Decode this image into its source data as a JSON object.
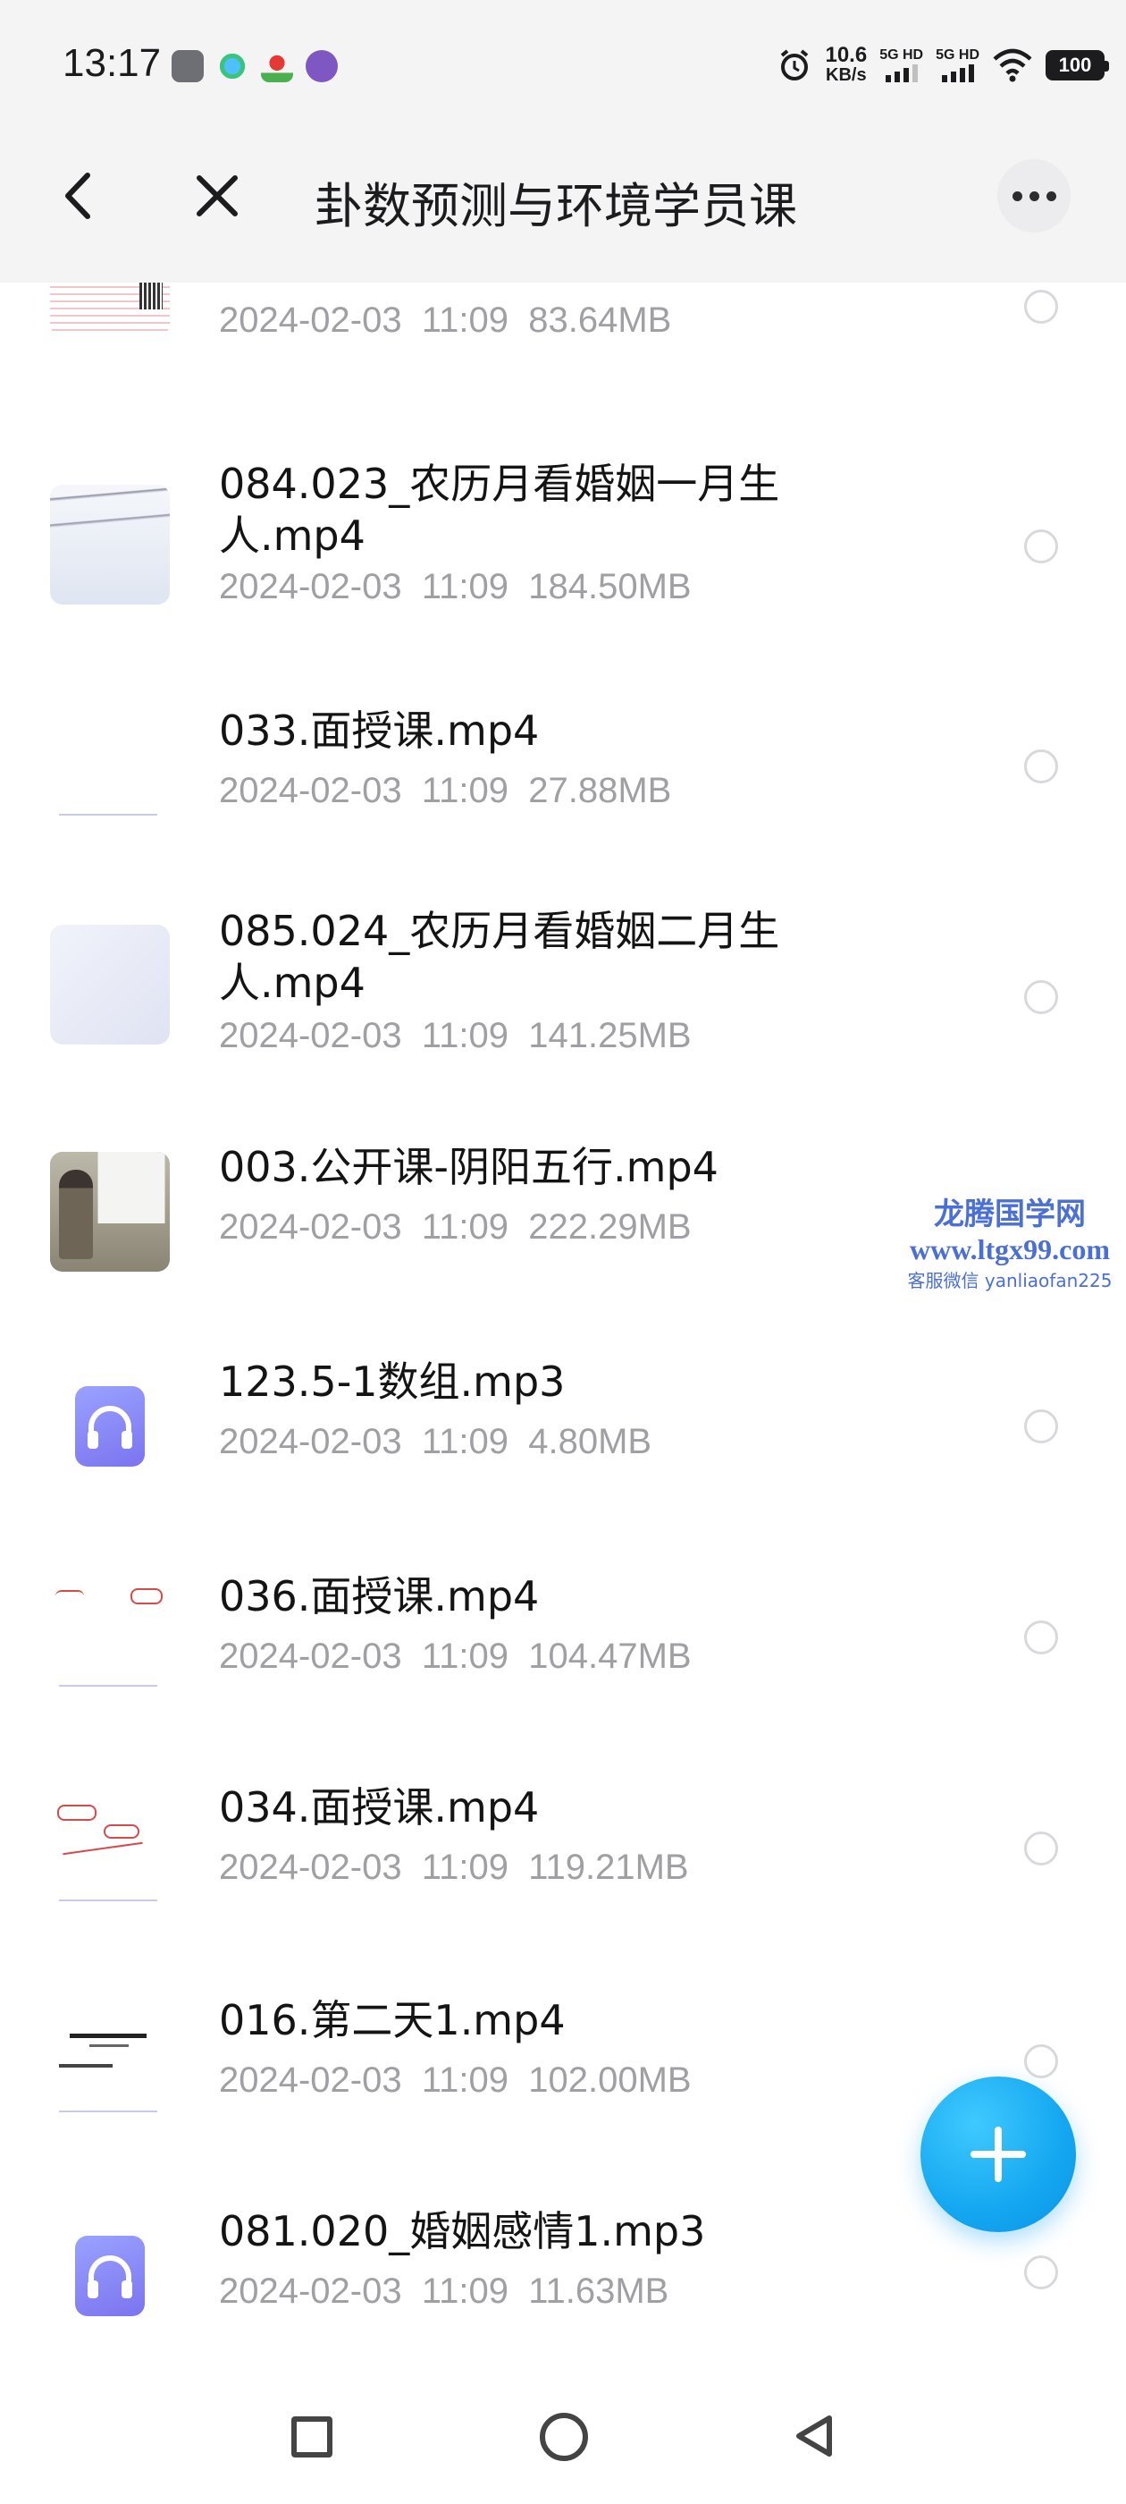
{
  "status_bar": {
    "time": "13:17",
    "net_speed_value": "10.6",
    "net_speed_unit": "KB/s",
    "sim1": "5G HD",
    "sim2": "5G HD",
    "battery": "100",
    "icons": [
      "gallery-icon",
      "cloud-app-icon",
      "map-app-icon",
      "link-app-icon",
      "alarm-icon",
      "wifi-icon",
      "battery-icon"
    ]
  },
  "header": {
    "title": "卦数预测与环境学员课"
  },
  "files": [
    {
      "name": "",
      "date": "2024-02-03",
      "time": "11:09",
      "size": "83.64MB",
      "thumb": "document"
    },
    {
      "name": "084.023_农历月看婚姻一月生人.mp4",
      "date": "2024-02-03",
      "time": "11:09",
      "size": "184.50MB",
      "thumb": "whiteboard-handwriting"
    },
    {
      "name": "033.面授课.mp4",
      "date": "2024-02-03",
      "time": "11:09",
      "size": "27.88MB",
      "thumb": "blank-slide"
    },
    {
      "name": "085.024_农历月看婚姻二月生人.mp4",
      "date": "2024-02-03",
      "time": "11:09",
      "size": "141.25MB",
      "thumb": "whiteboard"
    },
    {
      "name": "003.公开课-阴阳五行.mp4",
      "date": "2024-02-03",
      "time": "11:09",
      "size": "222.29MB",
      "thumb": "classroom"
    },
    {
      "name": "123.5-1数组.mp3",
      "date": "2024-02-03",
      "time": "11:09",
      "size": "4.80MB",
      "thumb": "audio"
    },
    {
      "name": "036.面授课.mp4",
      "date": "2024-02-03",
      "time": "11:09",
      "size": "104.47MB",
      "thumb": "slide-red"
    },
    {
      "name": "034.面授课.mp4",
      "date": "2024-02-03",
      "time": "11:09",
      "size": "119.21MB",
      "thumb": "slide-red-notes"
    },
    {
      "name": "016.第二天1.mp4",
      "date": "2024-02-03",
      "time": "11:09",
      "size": "102.00MB",
      "thumb": "title-slide"
    },
    {
      "name": "081.020_婚姻感情1.mp3",
      "date": "2024-02-03",
      "time": "11:09",
      "size": "11.63MB",
      "thumb": "audio"
    }
  ],
  "watermark": {
    "line1": "龙腾国学网",
    "line2": "www.ltgx99.com",
    "line3": "客服微信 yanliaofan225"
  },
  "colors": {
    "accent": "#14a7f0",
    "audio_icon": "#8a8cf7",
    "watermark": "#4a6fd6"
  }
}
